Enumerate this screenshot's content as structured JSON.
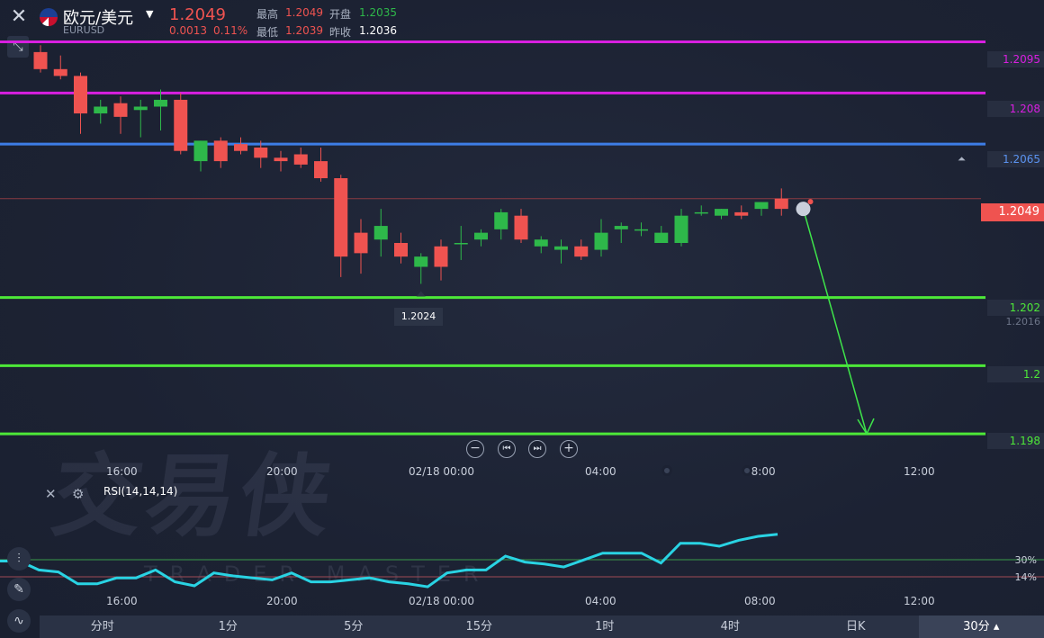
{
  "header": {
    "symbol_name": "欧元/美元",
    "symbol_code": "EURUSD",
    "last_price": "1.2049",
    "change_abs": "0.0013",
    "change_pct": "0.11%",
    "quote": {
      "high_label": "最高",
      "high": "1.2049",
      "open_label": "开盘",
      "open": "1.2035",
      "low_label": "最低",
      "low": "1.2039",
      "prev_close_label": "昨收",
      "prev_close": "1.2036"
    }
  },
  "colors": {
    "up": "#2eb84a",
    "down": "#ef5350",
    "magenta": "#d81fe0",
    "blue": "#3d7de6",
    "green_line": "#4de838",
    "rsi": "#29d3e3",
    "arrow": "#3ee44a"
  },
  "levels": [
    {
      "label": "1.2095",
      "color": "#d81fe0"
    },
    {
      "label": "1.208",
      "color": "#d81fe0"
    },
    {
      "label": "1.2065",
      "color": "#3d7de6"
    },
    {
      "label": "1.202",
      "color": "#4de838"
    },
    {
      "label": "1.2",
      "color": "#4de838"
    },
    {
      "label": "1.198",
      "color": "#4de838"
    }
  ],
  "current_price_tag": "1.2049",
  "scale_label_1": "1.2016",
  "low_marker": "1.2024",
  "chart_data": {
    "type": "candlestick",
    "note_levels": [
      1.2095,
      1.208,
      1.2065,
      1.202,
      1.2,
      1.198
    ],
    "candles": [
      {
        "o": 1.2092,
        "h": 1.2094,
        "l": 1.2086,
        "c": 1.2087
      },
      {
        "o": 1.2087,
        "h": 1.2091,
        "l": 1.2084,
        "c": 1.2085
      },
      {
        "o": 1.2085,
        "h": 1.2086,
        "l": 1.2068,
        "c": 1.2074
      },
      {
        "o": 1.2074,
        "h": 1.2078,
        "l": 1.2071,
        "c": 1.2076
      },
      {
        "o": 1.2077,
        "h": 1.2079,
        "l": 1.2068,
        "c": 1.2073
      },
      {
        "o": 1.2075,
        "h": 1.2078,
        "l": 1.2067,
        "c": 1.2076
      },
      {
        "o": 1.2076,
        "h": 1.2081,
        "l": 1.2069,
        "c": 1.2078
      },
      {
        "o": 1.2078,
        "h": 1.208,
        "l": 1.2062,
        "c": 1.2063
      },
      {
        "o": 1.206,
        "h": 1.2066,
        "l": 1.2057,
        "c": 1.2066
      },
      {
        "o": 1.2066,
        "h": 1.2067,
        "l": 1.2058,
        "c": 1.206
      },
      {
        "o": 1.2065,
        "h": 1.2067,
        "l": 1.2062,
        "c": 1.2063
      },
      {
        "o": 1.2064,
        "h": 1.2066,
        "l": 1.2058,
        "c": 1.2061
      },
      {
        "o": 1.2061,
        "h": 1.2063,
        "l": 1.2057,
        "c": 1.206
      },
      {
        "o": 1.2062,
        "h": 1.2064,
        "l": 1.2058,
        "c": 1.2059
      },
      {
        "o": 1.206,
        "h": 1.2064,
        "l": 1.2054,
        "c": 1.2055
      },
      {
        "o": 1.2055,
        "h": 1.2056,
        "l": 1.2026,
        "c": 1.2032
      },
      {
        "o": 1.2039,
        "h": 1.2043,
        "l": 1.2027,
        "c": 1.2033
      },
      {
        "o": 1.2037,
        "h": 1.2046,
        "l": 1.2032,
        "c": 1.2041
      },
      {
        "o": 1.2036,
        "h": 1.2039,
        "l": 1.203,
        "c": 1.2032
      },
      {
        "o": 1.2029,
        "h": 1.2033,
        "l": 1.2024,
        "c": 1.2032
      },
      {
        "o": 1.2035,
        "h": 1.2037,
        "l": 1.2025,
        "c": 1.2029
      },
      {
        "o": 1.2036,
        "h": 1.2041,
        "l": 1.2031,
        "c": 1.2036
      },
      {
        "o": 1.2037,
        "h": 1.204,
        "l": 1.2035,
        "c": 1.2039
      },
      {
        "o": 1.204,
        "h": 1.2046,
        "l": 1.2037,
        "c": 1.2045
      },
      {
        "o": 1.2044,
        "h": 1.2046,
        "l": 1.2036,
        "c": 1.2037
      },
      {
        "o": 1.2035,
        "h": 1.2038,
        "l": 1.2033,
        "c": 1.2037
      },
      {
        "o": 1.2034,
        "h": 1.2037,
        "l": 1.203,
        "c": 1.2035
      },
      {
        "o": 1.2035,
        "h": 1.2037,
        "l": 1.2031,
        "c": 1.2032
      },
      {
        "o": 1.2034,
        "h": 1.2043,
        "l": 1.2032,
        "c": 1.2039
      },
      {
        "o": 1.204,
        "h": 1.2042,
        "l": 1.2036,
        "c": 1.2041
      },
      {
        "o": 1.204,
        "h": 1.2042,
        "l": 1.2038,
        "c": 1.204
      },
      {
        "o": 1.2036,
        "h": 1.2041,
        "l": 1.2036,
        "c": 1.2039
      },
      {
        "o": 1.2036,
        "h": 1.2046,
        "l": 1.2035,
        "c": 1.2044
      },
      {
        "o": 1.2045,
        "h": 1.2047,
        "l": 1.2044,
        "c": 1.2045
      },
      {
        "o": 1.2044,
        "h": 1.2046,
        "l": 1.2043,
        "c": 1.2046
      },
      {
        "o": 1.2045,
        "h": 1.2047,
        "l": 1.2043,
        "c": 1.2044
      },
      {
        "o": 1.2046,
        "h": 1.2048,
        "l": 1.2044,
        "c": 1.2048
      },
      {
        "o": 1.2049,
        "h": 1.2052,
        "l": 1.2044,
        "c": 1.2046
      }
    ],
    "x_ticks": [
      "16:00",
      "20:00",
      "02/18 00:00",
      "04:00",
      "08:00",
      "12:00"
    ],
    "ylim": [
      1.197,
      1.2102
    ]
  },
  "rsi": {
    "label": "RSI(14,14,14)",
    "levels": [
      "30%",
      "14%"
    ],
    "values": [
      45,
      45,
      36,
      34,
      22,
      22,
      28,
      28,
      36,
      24,
      20,
      33,
      30,
      28,
      26,
      33,
      24,
      24,
      26,
      28,
      24,
      22,
      19,
      33,
      36,
      36,
      50,
      44,
      42,
      39,
      46,
      53,
      53,
      53,
      43,
      63,
      63,
      60,
      66,
      70,
      72
    ]
  },
  "controls": {
    "zoom_out": "−",
    "prev": "⏮",
    "next": "⏭",
    "zoom_in": "+"
  },
  "tabs": [
    "分时",
    "1分",
    "5分",
    "15分",
    "1时",
    "4时",
    "日K",
    "30分"
  ],
  "active_tab": "30分"
}
